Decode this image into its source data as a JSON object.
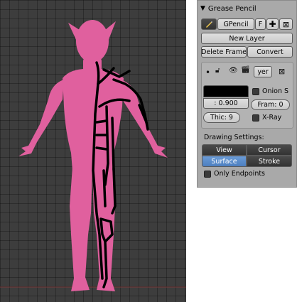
{
  "panel": {
    "title": "Grease Pencil",
    "collapse_icon": "triangle-down-icon",
    "datablock": {
      "pencil_icon": "pencil-icon",
      "name": "GPencil",
      "fake_user": "F",
      "add_icon": "plus-icon",
      "remove_icon": "x-icon"
    },
    "new_layer": "New Layer",
    "delete_frame": "Delete Frame",
    "convert": "Convert",
    "layer": {
      "name": "yer",
      "dot_icon": "dot-icon",
      "lock_icon": "lock-icon",
      "eye_icon": "eye-icon",
      "onion_icon": "clapper-icon",
      "remove_icon": "x-icon",
      "color": "#000000",
      "opacity": ": 0.900",
      "thickness": "Thic: 9",
      "onion_skin": "Onion S",
      "frames": "Fram: 0",
      "xray": "X-Ray"
    },
    "drawing_settings": {
      "title": "Drawing Settings:",
      "view": "View",
      "cursor": "Cursor",
      "surface": "Surface",
      "stroke": "Stroke",
      "active": "Surface",
      "only_endpoints": "Only Endpoints"
    }
  },
  "viewport": {
    "background": "#3d3d3d",
    "figure_color": "#e0609e",
    "stroke_color": "#000000"
  }
}
